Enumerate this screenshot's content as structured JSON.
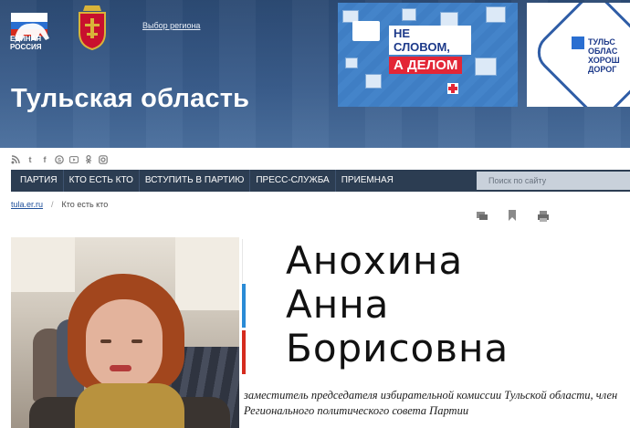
{
  "header": {
    "logo_text_line1": "ЕДИНАЯ",
    "logo_text_line2": "РОССИЯ",
    "region_link": "Выбор региона",
    "region_title": "Тульская область",
    "banner1": {
      "slogan_line1": "НЕ СЛОВОМ,",
      "slogan_line2": "А ДЕЛОМ"
    },
    "banner2": {
      "text_line1": "ТУЛЬС",
      "text_line2": "ОБЛАС",
      "text_line3": "ХОРОШ",
      "text_line4": "ДОРОГ"
    }
  },
  "social": {
    "items": [
      "rss-icon",
      "twitter-icon",
      "facebook-icon",
      "skype-icon",
      "youtube-icon",
      "odnoklassniki-icon",
      "instagram-icon"
    ]
  },
  "nav": {
    "items": [
      {
        "label": "ПАРТИЯ"
      },
      {
        "label": "КТО ЕСТЬ КТО"
      },
      {
        "label": "ВСТУПИТЬ В ПАРТИЮ"
      },
      {
        "label": "ПРЕСС-СЛУЖБА"
      },
      {
        "label": "ПРИЕМНАЯ"
      }
    ],
    "search_placeholder": "Поиск по сайту"
  },
  "breadcrumb": {
    "home": "tula.er.ru",
    "separator": "/",
    "current": "Кто есть кто"
  },
  "tools": [
    "comment-icon",
    "bookmark-icon",
    "print-icon"
  ],
  "profile": {
    "name_line1": "Анохина",
    "name_line2": "Анна",
    "name_line3": "Борисовна",
    "position": "заместитель председателя избирательной комиссии Тульской области, член Регионального политического совета Партии"
  },
  "colors": {
    "header_bg": "#3a5d8c",
    "nav_bg": "#2c3d52",
    "accent_white": "#ffffff",
    "accent_blue": "#2a8bd6",
    "accent_red": "#d52b1e"
  }
}
